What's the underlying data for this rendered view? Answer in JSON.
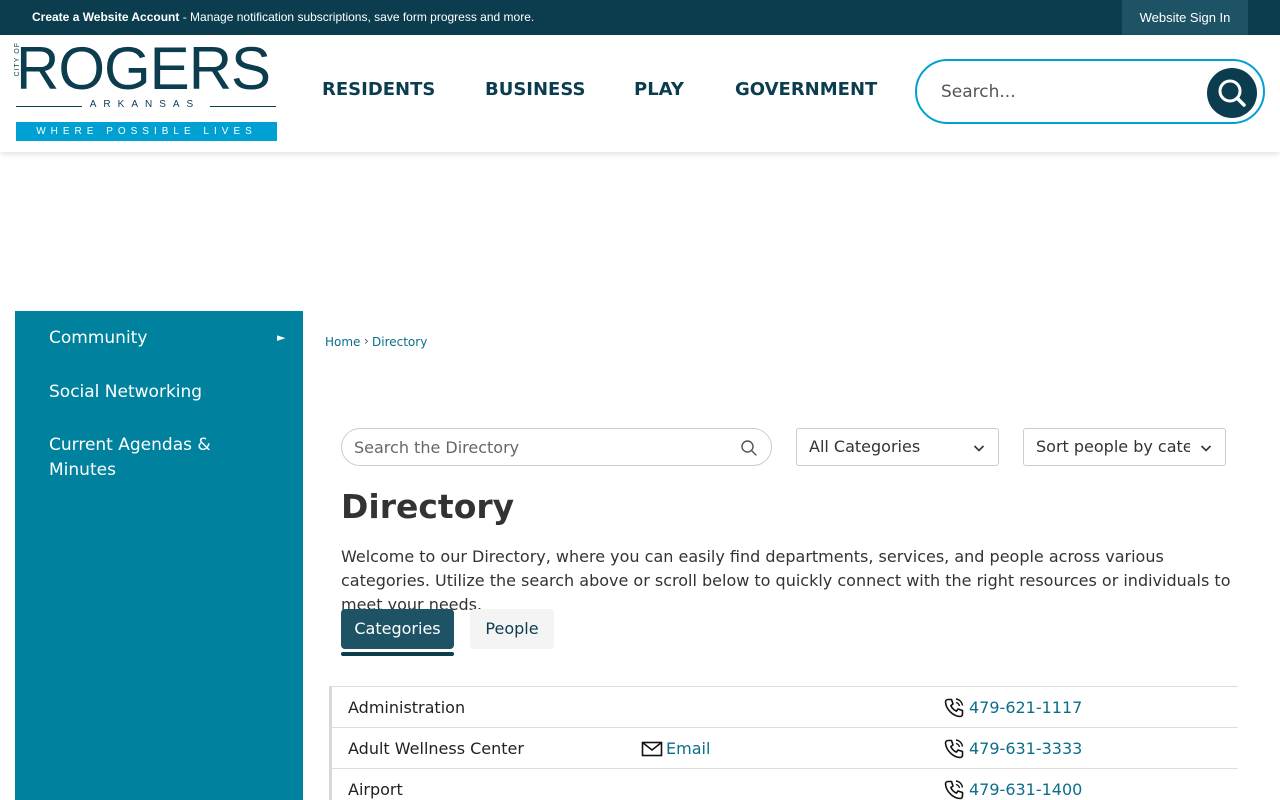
{
  "topbar": {
    "account_link": "Create a Website Account",
    "account_desc": " - Manage notification subscriptions, save form progress and more.",
    "signin": "Website Sign In"
  },
  "logo": {
    "city_of": "CITY OF",
    "main": "ROGERS",
    "state": "ARKANSAS",
    "tagline": "WHERE POSSIBLE LIVES"
  },
  "nav": {
    "items": [
      "RESIDENTS",
      "BUSINESS",
      "PLAY",
      "GOVERNMENT"
    ]
  },
  "header_search": {
    "placeholder": "Search..."
  },
  "sidebar": {
    "items": [
      {
        "label": "Community",
        "has_submenu": true
      },
      {
        "label": "Social Networking"
      },
      {
        "label": "Current Agendas & Minutes"
      }
    ]
  },
  "breadcrumb": {
    "home": "Home",
    "separator": "›",
    "current": "Directory"
  },
  "directory": {
    "search_placeholder": "Search the Directory",
    "category_filter": "All Categories",
    "sort_select": "Sort people by category",
    "title": "Directory",
    "intro": "Welcome to our Directory, where you can easily find departments, services, and people across various categories. Utilize the search above or scroll below to quickly connect with the right resources or individuals to meet your needs.",
    "tabs": [
      "Categories",
      "People"
    ],
    "active_tab": "Categories",
    "rows": [
      {
        "name": "Administration",
        "email": "",
        "phone": "479-621-1117"
      },
      {
        "name": "Adult Wellness Center",
        "email": "Email",
        "phone": "479-631-3333"
      },
      {
        "name": "Airport",
        "email": "",
        "phone": "479-631-1400"
      }
    ]
  },
  "colors": {
    "brand_dark": "#0b3d4f",
    "brand_teal": "#00829e",
    "brand_cyan": "#00a0d2",
    "link": "#0b6e8a"
  }
}
